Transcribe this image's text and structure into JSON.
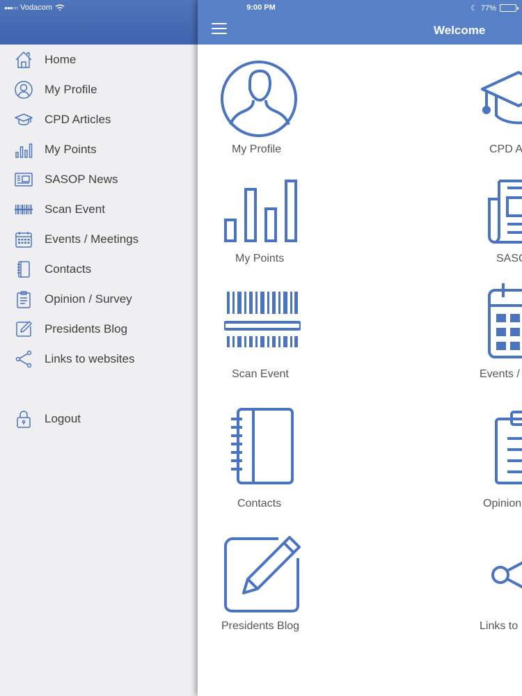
{
  "status_bar": {
    "carrier": "Vodacom",
    "time": "9:00 PM",
    "battery": "77%",
    "battery_level": 0.77
  },
  "nav_bar": {
    "title": "Welcome",
    "menu_icon": "hamburger-icon"
  },
  "side_menu": {
    "items": [
      {
        "label": "Home",
        "icon": "home-icon"
      },
      {
        "label": "My Profile",
        "icon": "profile-icon"
      },
      {
        "label": "CPD Articles",
        "icon": "graduation-cap-icon"
      },
      {
        "label": "My Points",
        "icon": "bar-chart-icon"
      },
      {
        "label": "SASOP News",
        "icon": "newspaper-icon"
      },
      {
        "label": "Scan Event",
        "icon": "barcode-icon"
      },
      {
        "label": "Events / Meetings",
        "icon": "calendar-icon"
      },
      {
        "label": "Contacts",
        "icon": "notebook-icon"
      },
      {
        "label": "Opinion / Survey",
        "icon": "clipboard-icon"
      },
      {
        "label": "Presidents Blog",
        "icon": "edit-icon"
      },
      {
        "label": "Links to websites",
        "icon": "share-icon"
      }
    ],
    "logout": {
      "label": "Logout",
      "icon": "lock-icon"
    }
  },
  "dashboard": {
    "tiles": [
      {
        "label": "My Profile",
        "icon": "profile-icon"
      },
      {
        "label": "CPD A",
        "icon": "graduation-cap-icon"
      },
      {
        "label": "My Points",
        "icon": "bar-chart-icon"
      },
      {
        "label": "SASO",
        "icon": "newspaper-icon"
      },
      {
        "label": "Scan Event",
        "icon": "barcode-icon"
      },
      {
        "label": "Events /",
        "icon": "calendar-icon"
      },
      {
        "label": "Contacts",
        "icon": "notebook-icon"
      },
      {
        "label": "Opinion",
        "icon": "clipboard-icon"
      },
      {
        "label": "Presidents Blog",
        "icon": "edit-icon"
      },
      {
        "label": "Links to",
        "icon": "share-icon"
      }
    ]
  },
  "colors": {
    "accent": "#5780c7",
    "icon": "#4a74c0",
    "menu_background": "#efeff2"
  }
}
